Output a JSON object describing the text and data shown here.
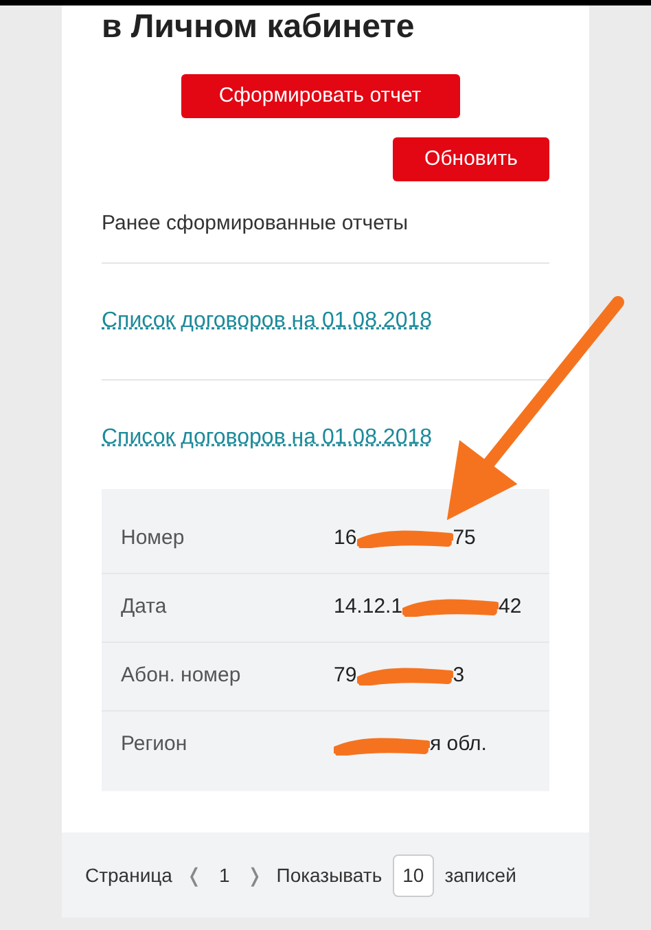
{
  "heading": "в Личном кабинете",
  "buttons": [
    {
      "label": "Сформировать отчет"
    },
    {
      "label": "Обновить"
    }
  ],
  "section_title": "Ранее сформированные отчеты",
  "reports": [
    {
      "label": "Список договоров на 01.08.2018"
    },
    {
      "label": "Список договоров на 01.08.2018"
    }
  ],
  "details": [
    {
      "label": "Номер",
      "value_start": "16",
      "value_end": "75",
      "redacted": true
    },
    {
      "label": "Дата",
      "value_start": "14.12.1",
      "value_end": "42",
      "redacted": true
    },
    {
      "label": "Абон. номер",
      "value_start": "79",
      "value_end": "3",
      "redacted": true
    },
    {
      "label": "Регион",
      "value_end": "я обл.",
      "redacted": true
    }
  ],
  "pagination": {
    "page_label": "Страница",
    "prev": "❬",
    "page": "1",
    "next": "❭",
    "show_label": "Показывать",
    "per_page": "10",
    "records_label": "записей"
  }
}
